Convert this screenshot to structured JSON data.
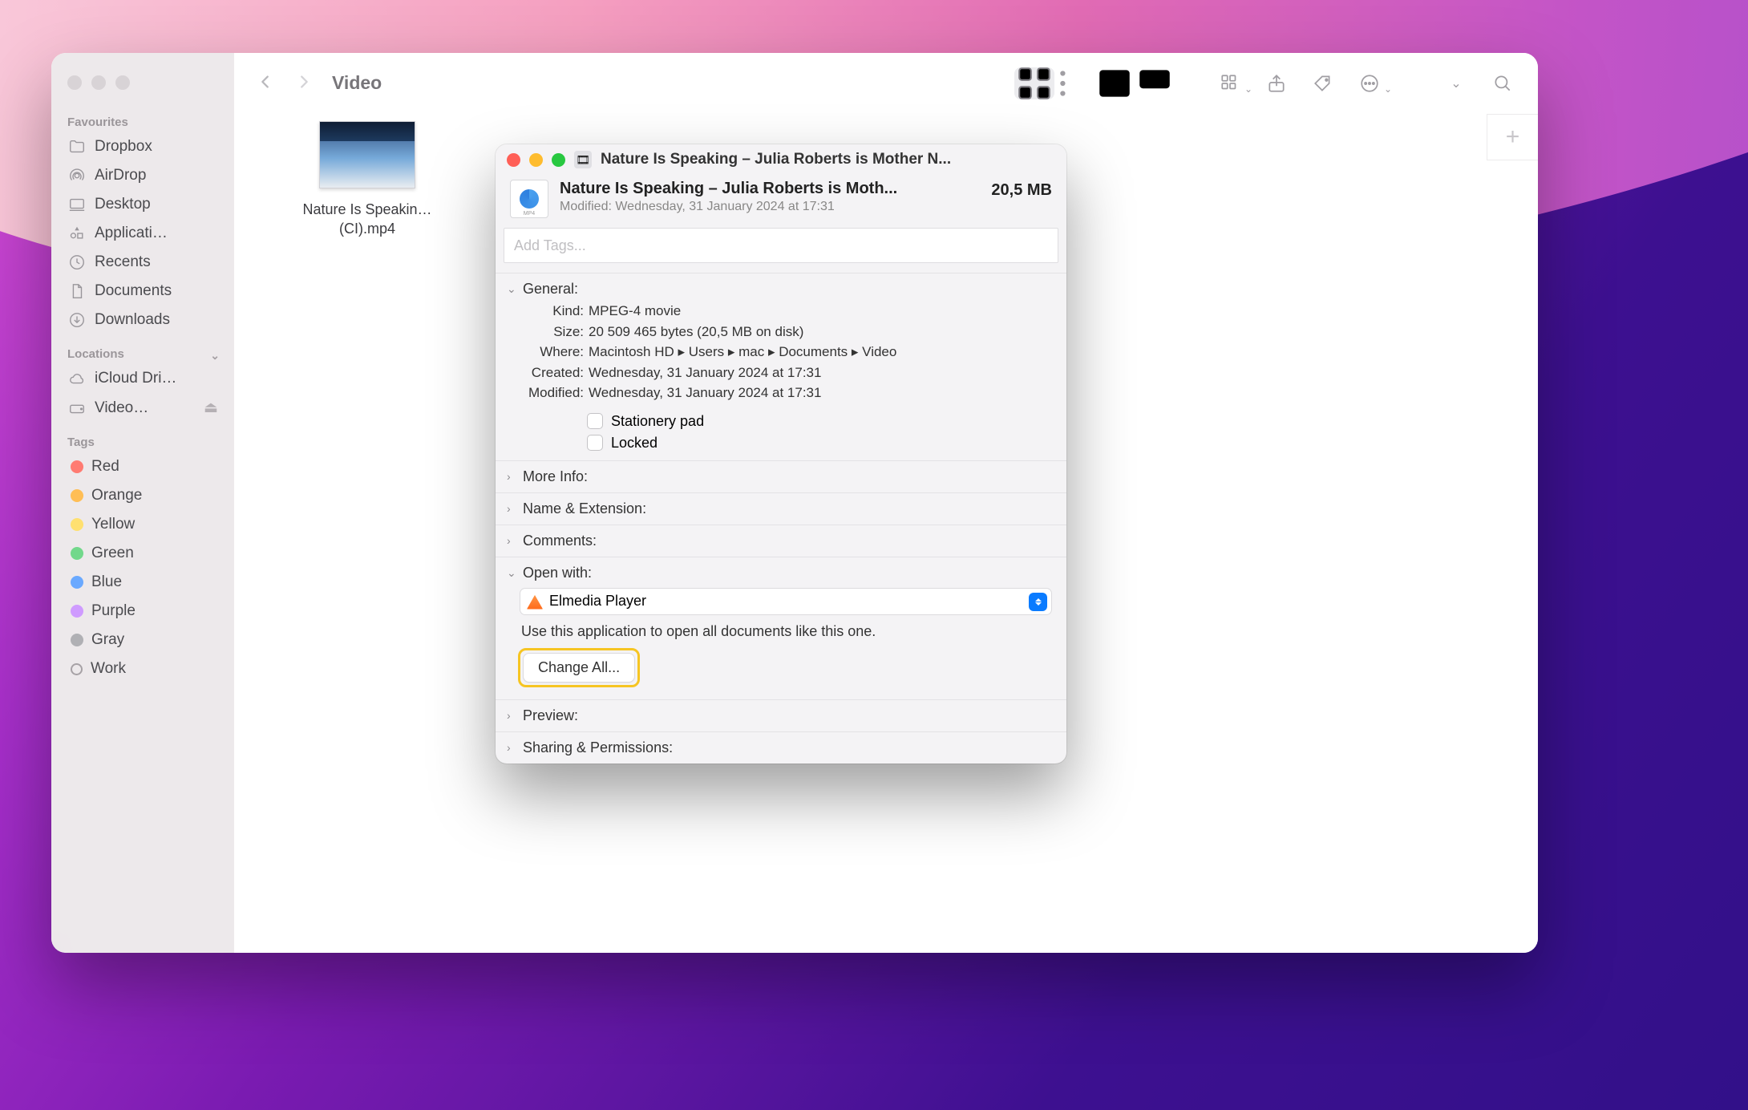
{
  "finder": {
    "folder_title": "Video",
    "file_label": "Nature Is Speakin…(CI).mp4",
    "backdrop_label": "Video",
    "sidebar": {
      "favourites_label": "Favourites",
      "favourites": [
        {
          "icon": "folder",
          "label": "Dropbox"
        },
        {
          "icon": "airdrop",
          "label": "AirDrop"
        },
        {
          "icon": "desktop",
          "label": "Desktop"
        },
        {
          "icon": "apps",
          "label": "Applicati…"
        },
        {
          "icon": "recents",
          "label": "Recents"
        },
        {
          "icon": "doc",
          "label": "Documents"
        },
        {
          "icon": "downloads",
          "label": "Downloads"
        }
      ],
      "locations_label": "Locations",
      "locations": [
        {
          "icon": "cloud",
          "label": "iCloud Dri…",
          "eject": false
        },
        {
          "icon": "disk",
          "label": "Video…",
          "eject": true
        }
      ],
      "tags_label": "Tags",
      "tags": [
        {
          "color": "#ff7b72",
          "label": "Red"
        },
        {
          "color": "#ffbe55",
          "label": "Orange"
        },
        {
          "color": "#ffe070",
          "label": "Yellow"
        },
        {
          "color": "#72d88b",
          "label": "Green"
        },
        {
          "color": "#6aa9ff",
          "label": "Blue"
        },
        {
          "color": "#cf9bff",
          "label": "Purple"
        },
        {
          "color": "#b0b0b4",
          "label": "Gray"
        },
        {
          "color": null,
          "label": "Work"
        }
      ]
    }
  },
  "info": {
    "titlebar": "Nature Is Speaking – Julia Roberts is Mother N...",
    "filename": "Nature Is Speaking – Julia Roberts is Moth...",
    "filesize": "20,5 MB",
    "modified_line": "Modified:  Wednesday, 31 January 2024 at 17:31",
    "tags_placeholder": "Add Tags...",
    "general_label": "General:",
    "kv": {
      "kind": {
        "k": "Kind:",
        "v": "MPEG-4 movie"
      },
      "size": {
        "k": "Size:",
        "v": "20 509 465 bytes (20,5 MB on disk)"
      },
      "where": {
        "k": "Where:",
        "v": "Macintosh HD ▸ Users ▸ mac ▸ Documents ▸ Video"
      },
      "created": {
        "k": "Created:",
        "v": "Wednesday, 31 January 2024 at 17:31"
      },
      "modified": {
        "k": "Modified:",
        "v": "Wednesday, 31 January 2024 at 17:31"
      }
    },
    "stationery_label": "Stationery pad",
    "locked_label": "Locked",
    "moreinfo_label": "More Info:",
    "nameext_label": "Name & Extension:",
    "comments_label": "Comments:",
    "openwith_label": "Open with:",
    "openwith_app": "Elmedia Player",
    "openwith_hint": "Use this application to open all documents like this one.",
    "changeall_label": "Change All...",
    "preview_label": "Preview:",
    "sharing_label": "Sharing & Permissions:"
  }
}
